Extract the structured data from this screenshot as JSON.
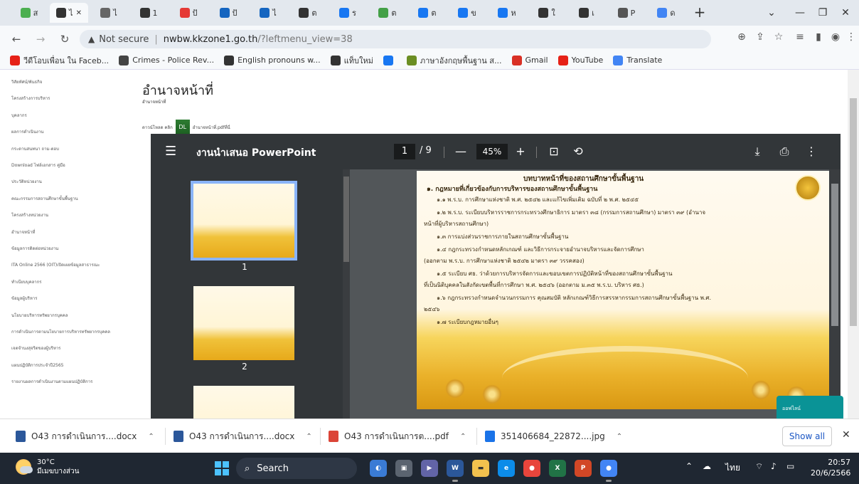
{
  "browser": {
    "tab_badges": [
      "ส",
      "ไ",
      "ไ",
      "1",
      "ปั",
      "ปั",
      "ไ",
      "ต",
      "ร",
      "ต",
      "ต",
      "ข",
      "ห",
      "ใ",
      "เ",
      "P",
      "ด"
    ],
    "address": {
      "security_label": "Not secure",
      "host": "nwbw.kkzone1.go.th",
      "path": "/?leftmenu_view=38"
    },
    "bookmarks": [
      {
        "label": "วีดีโอบเพื่อน ใน Faceb...",
        "icon": "youtube-icon",
        "color": "#e62117"
      },
      {
        "label": "Crimes - Police Rev...",
        "icon": "circle-icon",
        "color": "#444"
      },
      {
        "label": "English pronouns w...",
        "icon": "chrome-icon",
        "color": "#333"
      },
      {
        "label": "แท็บใหม่",
        "icon": "chrome-icon",
        "color": "#333"
      },
      {
        "label": "",
        "icon": "facebook-icon",
        "color": "#1877f2"
      },
      {
        "label": "ภาษาอังกฤษพื้นฐาน ส...",
        "icon": "person-icon",
        "color": "#6b8e23"
      },
      {
        "label": "Gmail",
        "icon": "gmail-icon",
        "color": "#d93025"
      },
      {
        "label": "YouTube",
        "icon": "youtube-icon",
        "color": "#e62117"
      },
      {
        "label": "Translate",
        "icon": "translate-icon",
        "color": "#4285f4"
      }
    ]
  },
  "leftmenu": {
    "items": [
      "วิสัยทัศน์/พันธกิจ",
      "โครงสร้างการบริหาร",
      "บุคลากร",
      "ผลการดำเนินงาน",
      "กระดานสนทนา ถาม-ตอบ",
      "Download ไฟล์เอกสาร คู่มือ",
      "ประวัติหน่วยงาน",
      "คณะกรรมการสถานศึกษาขั้นพื้นฐาน",
      "โครงสร้างหน่วยงาน",
      "อำนาจหน้าที่",
      "ข้อมูลการติดต่อหน่วยงาน",
      "ITA Online 2566 (OIT)เปิดเผยข้อมูลสาธารณะ",
      "ทำเนียบบุคลากร",
      "ข้อมูลผู้บริหาร",
      "นโยบายบริหารทรัพยากรบุคคล",
      "การดำเนินการตามนโยบายการบริหารทรัพยากรบุคคล",
      "เจตจำนงสุจริตของผู้บริหาร",
      "แผนปฏิบัติการประจำปี2565",
      "รายงานผลการดำเนินงานตามแผนปฏิบัติการ"
    ]
  },
  "content": {
    "title": "อำนาจหน้าที่",
    "subtitle": "อำนาจหน้าที่",
    "download_prefix": "ดาวน์โหลด คลิก",
    "download_file": "อำนาจหน้าที่.pdfที่นี่"
  },
  "viewer": {
    "title": "งานนำเสนอ PowerPoint",
    "current_page": "1",
    "total_pages": "/ 9",
    "zoom": "45%",
    "thumb_labels": [
      "1",
      "2"
    ],
    "doc": {
      "heading": "บทบาทหน้าที่ของสถานศึกษาขั้นพื้นฐาน",
      "section": "๑. กฎหมายที่เกี่ยวข้องกับการบริหารของสถานศึกษาขั้นพื้นฐาน",
      "lines": [
        "๑.๑ พ.ร.บ.     การศึกษาแห่งชาติ พ.ศ. ๒๕๔๒ และแก้ไขเพิ่มเติม ฉบับที่ ๒ พ.ศ. ๒๕๔๕",
        "๑.๒ พ.ร.บ.     ระเบียบบริหารราชการกระทรวงศึกษาธิการ มาตรา ๓๘ (กรรมการสถานศึกษา) มาตรา ๓๙ (อำนาจ",
        "หน้าที่ผู้บริหารสถานศึกษา)",
        "๑.๓ การแบ่งส่วนราชการภายในสถานศึกษาขั้นพื้นฐาน",
        "๑.๔ กฎกระทรวงกำหนดหลักเกณฑ์ และวิธีการกระจายอำนาจบริหารและจัดการศึกษา",
        "(ออกตาม พ.ร.บ. การศึกษาแห่งชาติ ๒๕๔๒ มาตรา ๓๙ วรรคสอง)",
        "๑.๕ ระเบียบ ศธ. ว่าด้วยการบริหารจัดการและขอบเขตการปฏิบัติหน้าที่ของสถานศึกษาขั้นพื้นฐาน",
        "ที่เป็นนิติบุคคลในสังกัดเขตพื้นที่การศึกษา พ.ศ. ๒๕๔๖ (ออกตาม ม.๓๕ พ.ร.บ. บริหาร ศธ.)",
        "๑.๖ กฎกระทรวงกำหนดจำนวนกรรมการ คุณสมบัติ หลักเกณฑ์วิธีการสรรหากรรมการสถานศึกษาขั้นพื้นฐาน พ.ศ.",
        "๒๕๔๖",
        "๑.๗ ระเบียบกฎหมายอื่นๆ"
      ]
    }
  },
  "chat_label": "ออฟไลน์",
  "downloads": {
    "items": [
      {
        "name": "O43 การดำเนินการ....docx",
        "icon": "word-file-icon",
        "color": "#2b579a"
      },
      {
        "name": "O43 การดำเนินการ....docx",
        "icon": "word-file-icon",
        "color": "#2b579a"
      },
      {
        "name": "O43 การดำเนินการต....pdf",
        "icon": "chrome-file-icon",
        "color": "#db4437"
      },
      {
        "name": "351406684_22872....jpg",
        "icon": "image-file-icon",
        "color": "#1a73e8"
      }
    ],
    "show_all": "Show all"
  },
  "taskbar": {
    "temperature": "30°C",
    "weather": "มีเมฆบางส่วน",
    "search_label": "Search",
    "lang": "ไทย",
    "time": "20:57",
    "date": "20/6/2566"
  }
}
